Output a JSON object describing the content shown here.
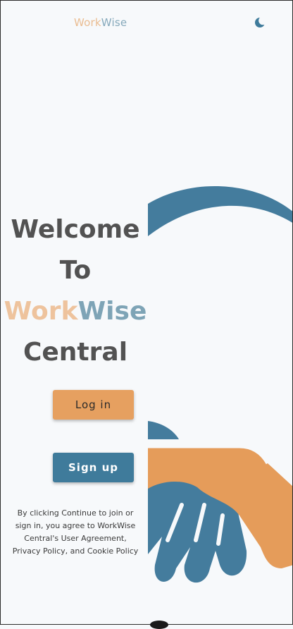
{
  "header": {
    "brand_work": "Work",
    "brand_wise": "Wise",
    "theme_toggle_icon": "moon-icon"
  },
  "hero": {
    "line1": "Welcome",
    "line2": "To",
    "brand_work": "Work",
    "brand_wise": "Wise",
    "line4": "Central"
  },
  "actions": {
    "login_label": "Log in",
    "signup_label": "Sign up"
  },
  "legal_text": "By clicking Continue to join or sign in, you agree to WorkWise Central's User Agreement, Privacy Policy, and Cookie Policy",
  "illustration": "handshake-illustration",
  "colors": {
    "orange": "#e6a060",
    "blue": "#3f7b9b",
    "brand_work": "#eec39d",
    "brand_wise": "#7ea4b6",
    "heading": "#525252",
    "background": "#f7f9fb"
  }
}
